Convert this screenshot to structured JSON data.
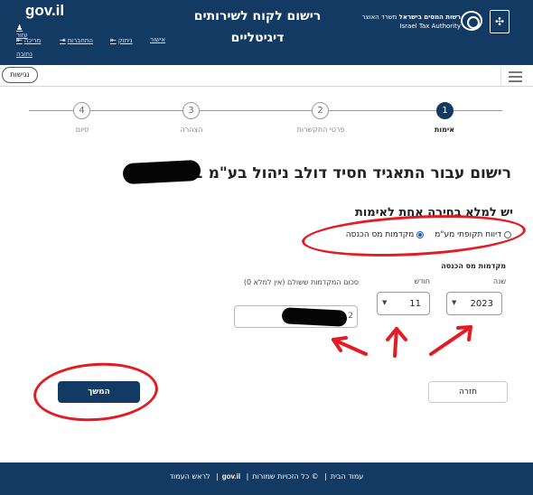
{
  "header": {
    "gov_logo": "gov.il",
    "links": {
      "help": "עזור",
      "approval": "אישור",
      "login": "ניתוק",
      "connections": "התחברות",
      "more": "מריכה",
      "close": "נחובה"
    },
    "title_line1": "רישום לקוח לשירותים",
    "title_line2": "דיגיטליים",
    "tax_authority_he": "רשות המסים בישראל",
    "tax_authority_he2": "משרד האוצר",
    "tax_authority_en": "Israel Tax Authority"
  },
  "subbar": {
    "accessibility_label": "נגישות"
  },
  "stepper": {
    "steps": [
      {
        "number": "1",
        "label": "אימות"
      },
      {
        "number": "2",
        "label": "פרטי התקשרות"
      },
      {
        "number": "3",
        "label": "הצהרה"
      },
      {
        "number": "4",
        "label": "סיום"
      }
    ],
    "active_step": 1
  },
  "main": {
    "page_title": "רישום עבור התאגיד חסיד דולב ניהול בע\"מ 51",
    "instruction": "יש למלא בחירה אחת לאימות",
    "radio_options": [
      {
        "label": "מקדמות מס הכנסה",
        "checked": true
      },
      {
        "label": "דיווח תקופתי מע\"מ",
        "checked": false
      }
    ],
    "section_title": "מקדמות מס הכנסה",
    "year_label": "שנה",
    "year_value": "2023",
    "month_label": "חודש",
    "month_value": "11",
    "amount_label": "סכום המקדמות ששולם (אין למלא 0)",
    "amount_value": "2",
    "continue_label": "המשך",
    "back_label": "חזרה"
  },
  "footer": {
    "home": "עמוד הבית",
    "rights": "© כל הזכויות שמורות",
    "gov": "gov.il",
    "top": "לראש העמוד"
  },
  "colors": {
    "primary": "#123a63",
    "annotation": "#e31b23",
    "radio": "#1a55c4"
  },
  "icons": [
    "hamburger-icon",
    "chevron-down-icon",
    "emblem-icon"
  ]
}
